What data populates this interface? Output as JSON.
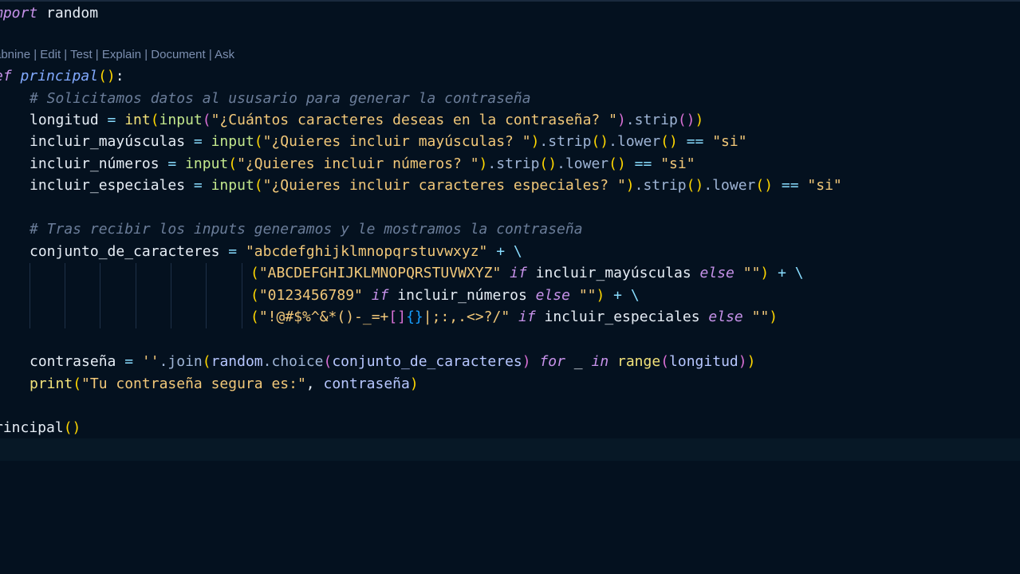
{
  "codelens": {
    "items": [
      "abnine",
      "Edit",
      "Test",
      "Explain",
      "Document",
      "Ask"
    ],
    "separator": " | "
  },
  "code": {
    "l1": {
      "kw": "mport",
      "mod": " random"
    },
    "l2": {
      "kw": "ef",
      "name": "principal",
      "open": "(",
      "close": ")",
      "colon": ":"
    },
    "l3": {
      "comment": "# Solicitamos datos al ususario para generar la contraseña"
    },
    "l4": {
      "var": "longitud",
      "eq": " = ",
      "int": "int",
      "p1": "(",
      "input": "input",
      "p2": "(",
      "str": "\"¿Cuántos caracteres deseas en la contraseña? \"",
      "p2c": ")",
      "strip": ".strip",
      "p3": "()",
      "p1c": ")"
    },
    "l5": {
      "var": "incluir_mayúsculas",
      "eq": " = ",
      "input": "input",
      "p1": "(",
      "str": "\"¿Quieres incluir mayúsculas? \"",
      "p1c": ")",
      "strip": ".strip",
      "p1b": "()",
      "lower": ".lower",
      "p1d": "()",
      "eqeq": " == ",
      "si": "\"si\""
    },
    "l6": {
      "var": "incluir_números",
      "eq": " = ",
      "input": "input",
      "p1": "(",
      "str": "\"¿Quieres incluir números? \"",
      "p1c": ")",
      "strip": ".strip",
      "p1b": "()",
      "lower": ".lower",
      "p1d": "()",
      "eqeq": " == ",
      "si": "\"si\""
    },
    "l7": {
      "var": "incluir_especiales",
      "eq": " = ",
      "input": "input",
      "p1": "(",
      "str": "\"¿Quieres incluir caracteres especiales? \"",
      "p1c": ")",
      "strip": ".strip",
      "p1b": "()",
      "lower": ".lower",
      "p1d": "()",
      "eqeq": " == ",
      "si": "\"si\""
    },
    "l8": {
      "comment": "# Tras recibir los inputs generamos y le mostramos la contraseña"
    },
    "l9": {
      "var": "conjunto_de_caracteres",
      "eq": " = ",
      "str": "\"abcdefghijklmnopqrstuvwxyz\"",
      "plus": " + \\"
    },
    "l10": {
      "p1": "(",
      "str": "\"ABCDEFGHIJKLMNOPQRSTUVWXYZ\"",
      "if": " if",
      "var": " incluir_mayúsculas",
      "else": " else",
      "empty": " \"\"",
      "p1c": ")",
      "plus": " + \\"
    },
    "l11": {
      "p1": "(",
      "str": "\"0123456789\"",
      "if": " if",
      "var": " incluir_números",
      "else": " else",
      "empty": " \"\"",
      "p1c": ")",
      "plus": " + \\"
    },
    "l12": {
      "p1": "(",
      "s1": "\"!@#$%^&*()-_=+",
      "b1": "[]",
      "b2": "{}",
      "s2": "|;:,.<>?/\"",
      "if": " if",
      "var": " incluir_especiales",
      "else": " else",
      "empty": " \"\"",
      "p1c": ")"
    },
    "l13": {
      "var": "contraseña",
      "eq": " = ",
      "str": "''",
      "join": ".join",
      "p1": "(",
      "random": "random",
      "choice": ".choice",
      "p2": "(",
      "arg": "conjunto_de_caracteres",
      "p2c": ")",
      "for": " for",
      "us": " _",
      "in": " in",
      "range": " range",
      "p2b": "(",
      "arg2": "longitud",
      "p2bc": ")",
      "p1c": ")"
    },
    "l14": {
      "print": "print",
      "p1": "(",
      "str": "\"Tu contraseña segura es:\"",
      "comma": ", ",
      "arg": "contraseña",
      "p1c": ")"
    },
    "l15": {
      "call": "rincipal",
      "p1": "()"
    }
  }
}
